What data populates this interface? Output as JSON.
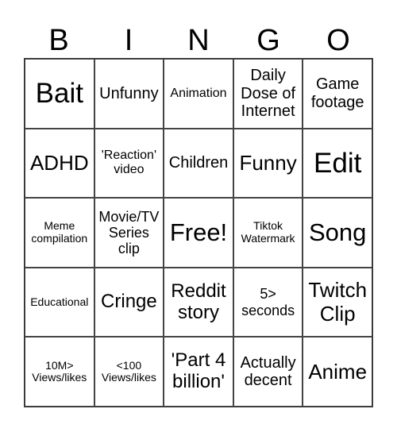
{
  "title_letters": [
    "B",
    "I",
    "N",
    "G",
    "O"
  ],
  "cells": [
    [
      "Bait",
      "Unfunny",
      "Animation",
      "Daily Dose of Internet",
      "Game footage"
    ],
    [
      "ADHD",
      "'Reaction' video",
      "Children",
      "Funny",
      "Edit"
    ],
    [
      "Meme compilation",
      "Movie/TV Series clip",
      "Free!",
      "Tiktok Watermark",
      "Song"
    ],
    [
      "Educational",
      "Cringe",
      "Reddit story",
      "5> seconds",
      "Twitch Clip"
    ],
    [
      "10M> Views/likes",
      "<100 Views/likes",
      "'Part 4 billion'",
      "Actually decent",
      "Anime"
    ]
  ],
  "free_space": "Free!"
}
